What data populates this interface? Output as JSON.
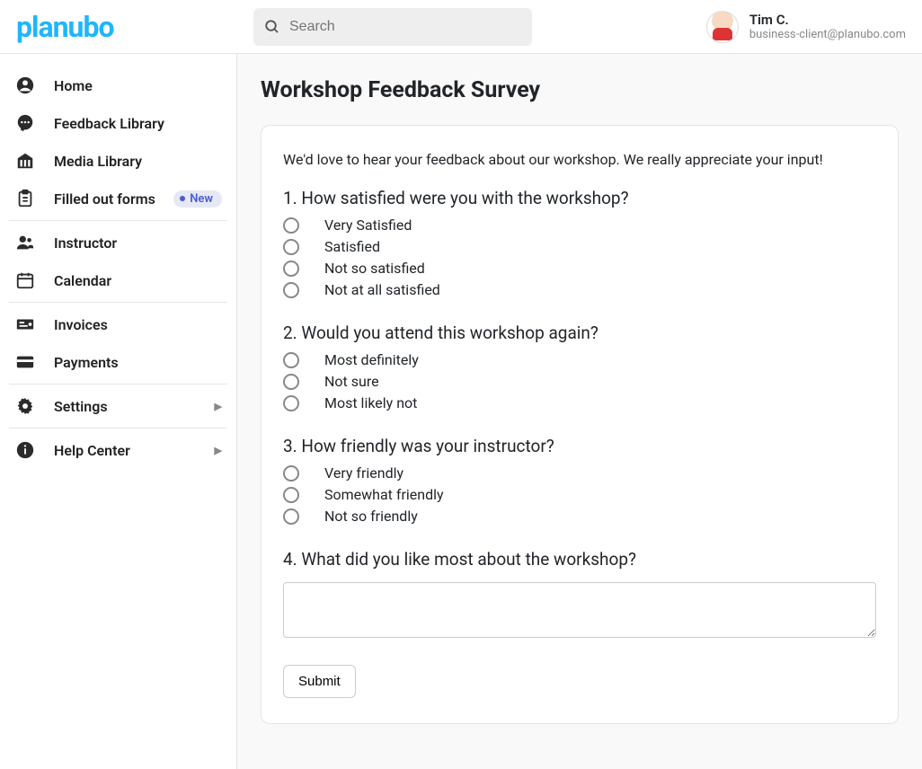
{
  "brand": {
    "name": "planubo"
  },
  "search": {
    "placeholder": "Search"
  },
  "user": {
    "name": "Tim C.",
    "email": "business-client@planubo.com"
  },
  "sidebar": {
    "items": [
      {
        "label": "Home",
        "icon": "account-circle"
      },
      {
        "label": "Feedback Library",
        "icon": "chat"
      },
      {
        "label": "Media Library",
        "icon": "library"
      },
      {
        "label": "Filled out forms",
        "icon": "clipboard",
        "badge": "New",
        "sep_after": true
      },
      {
        "label": "Instructor",
        "icon": "people"
      },
      {
        "label": "Calendar",
        "icon": "calendar",
        "sep_after": true
      },
      {
        "label": "Invoices",
        "icon": "invoice"
      },
      {
        "label": "Payments",
        "icon": "card",
        "sep_after": true
      },
      {
        "label": "Settings",
        "icon": "gear",
        "chevron": true,
        "sep_after": true
      },
      {
        "label": "Help Center",
        "icon": "info",
        "chevron": true
      }
    ]
  },
  "page": {
    "title": "Workshop Feedback Survey",
    "intro": "We'd love to hear your feedback about our workshop. We really appreciate your input!",
    "questions": [
      {
        "text": "1. How satisfied were you with the workshop?",
        "options": [
          "Very Satisfied",
          "Satisfied",
          "Not so satisfied",
          "Not at all satisfied"
        ]
      },
      {
        "text": "2. Would you attend this workshop again?",
        "options": [
          "Most definitely",
          "Not sure",
          "Most likely not"
        ]
      },
      {
        "text": "3. How friendly was your instructor?",
        "options": [
          "Very friendly",
          "Somewhat friendly",
          "Not so friendly"
        ]
      },
      {
        "text": "4. What did you like most about the workshop?",
        "freeform": true
      }
    ],
    "submit_label": "Submit"
  }
}
